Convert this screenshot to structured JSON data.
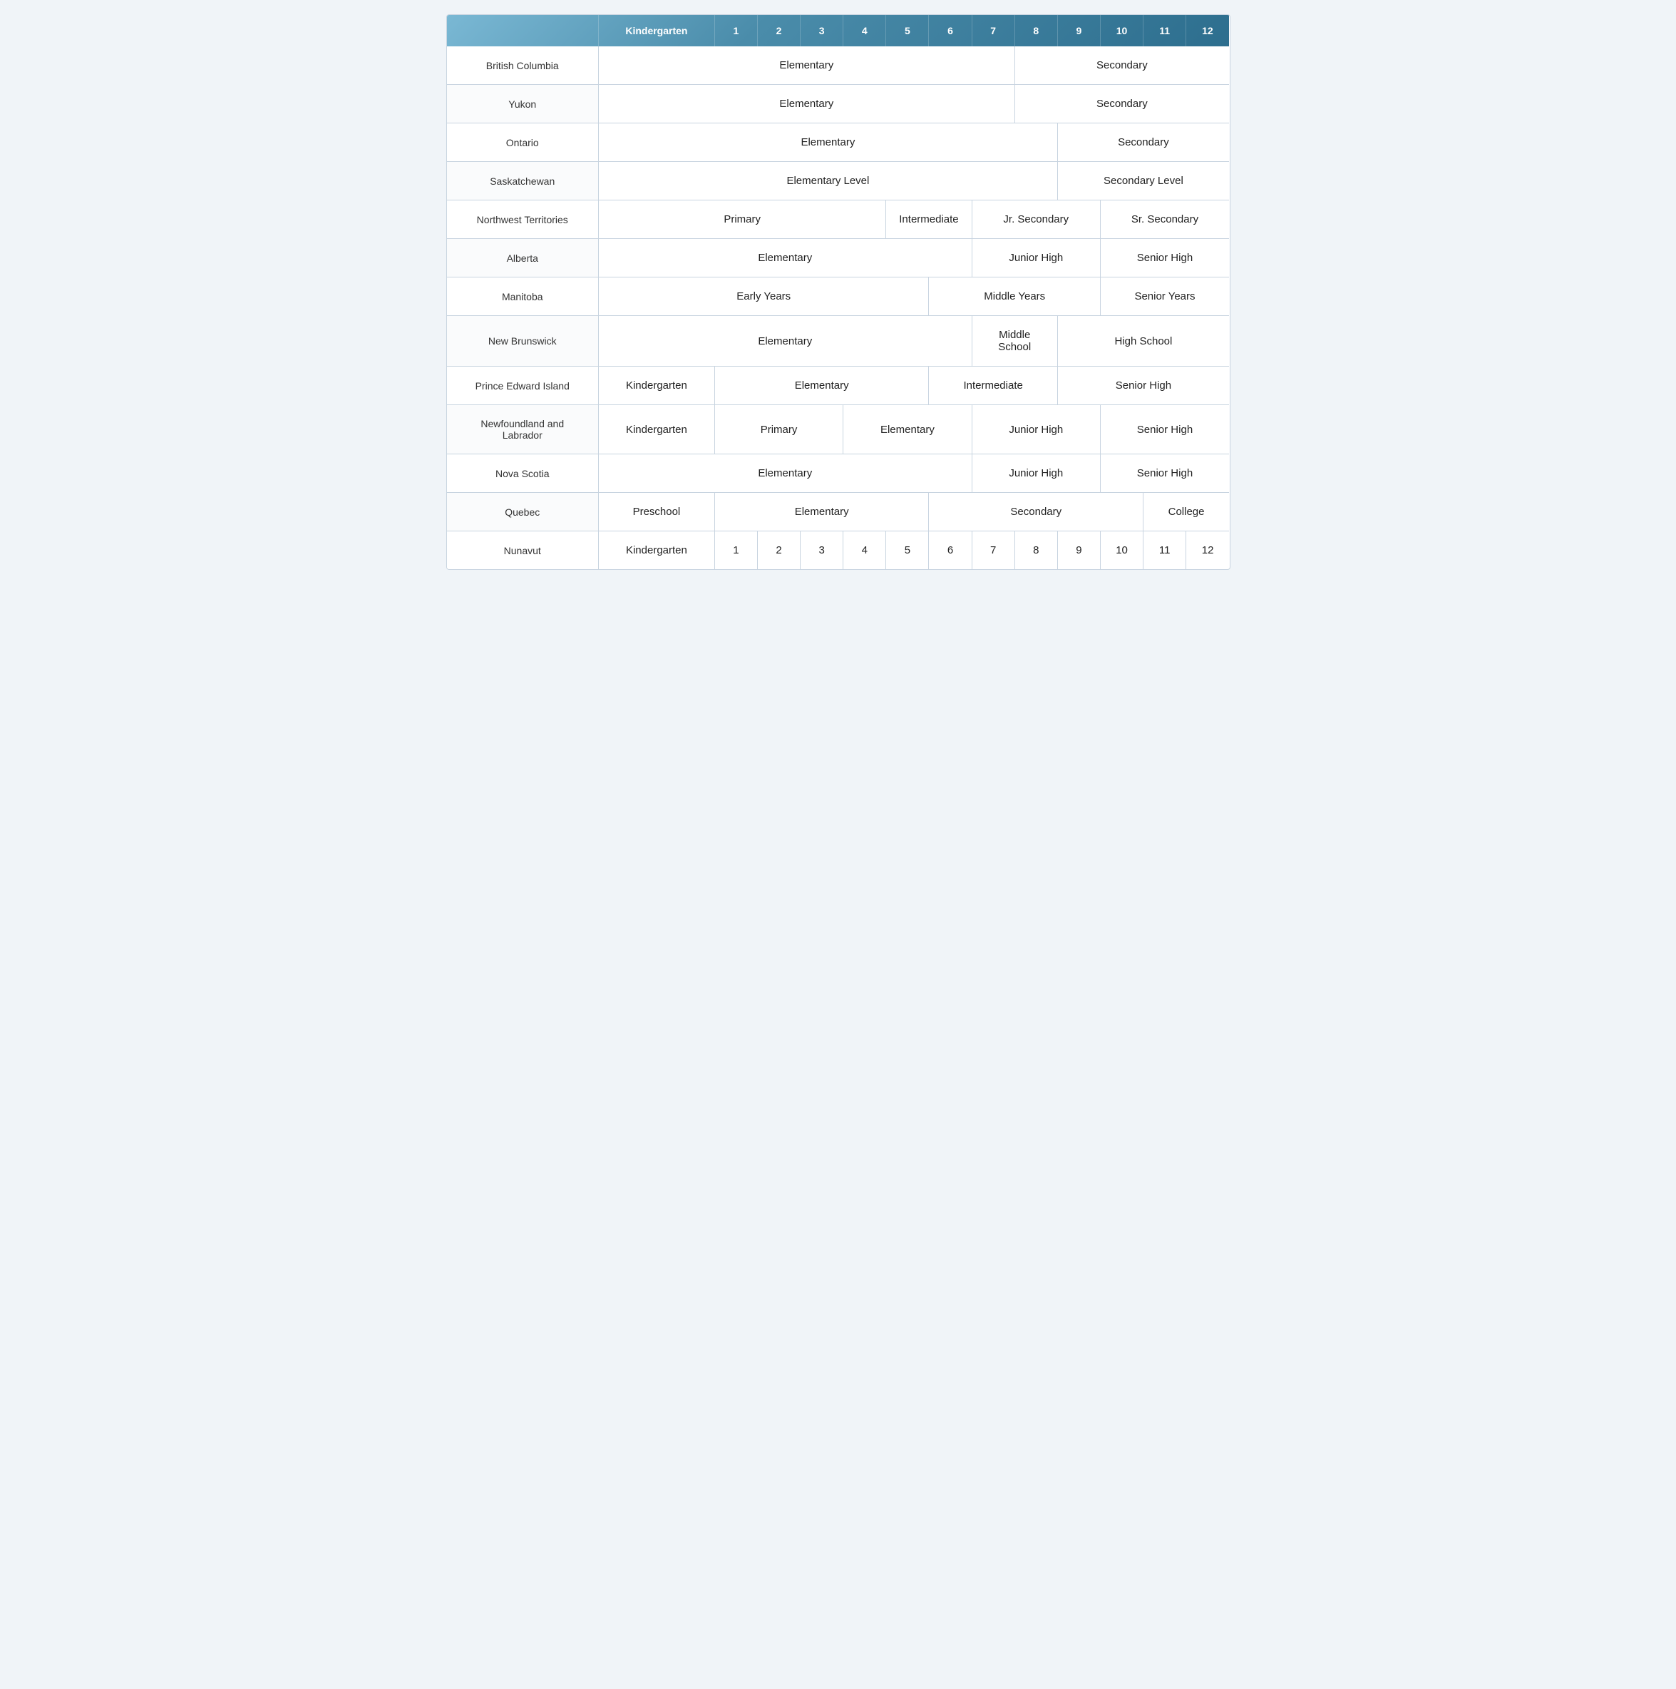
{
  "header": {
    "col0": "",
    "colKG": "Kindergarten",
    "col1": "1",
    "col2": "2",
    "col3": "3",
    "col4": "4",
    "col5": "5",
    "col6": "6",
    "col7": "7",
    "col8": "8",
    "col9": "9",
    "col10": "10",
    "col11": "11",
    "col12": "12"
  },
  "rows": [
    {
      "province": "British Columbia",
      "cells": [
        {
          "label": "Elementary",
          "colspan": 8,
          "grades": "K-7"
        },
        {
          "label": "Secondary",
          "colspan": 5,
          "grades": "8-12"
        }
      ]
    },
    {
      "province": "Yukon",
      "cells": [
        {
          "label": "Elementary",
          "colspan": 8,
          "grades": "K-7"
        },
        {
          "label": "Secondary",
          "colspan": 5,
          "grades": "8-12"
        }
      ]
    },
    {
      "province": "Ontario",
      "cells": [
        {
          "label": "Elementary",
          "colspan": 9,
          "grades": "K-8"
        },
        {
          "label": "Secondary",
          "colspan": 4,
          "grades": "9-12"
        }
      ]
    },
    {
      "province": "Saskatchewan",
      "cells": [
        {
          "label": "Elementary Level",
          "colspan": 9,
          "grades": "K-8"
        },
        {
          "label": "Secondary Level",
          "colspan": 4,
          "grades": "9-12"
        }
      ]
    },
    {
      "province": "Northwest Territories",
      "cells": [
        {
          "label": "Primary",
          "colspan": 5,
          "grades": "K-4"
        },
        {
          "label": "Intermediate",
          "colspan": 2,
          "grades": "5-6"
        },
        {
          "label": "Jr. Secondary",
          "colspan": 3,
          "grades": "7-9"
        },
        {
          "label": "Sr. Secondary",
          "colspan": 3,
          "grades": "10-12"
        }
      ]
    },
    {
      "province": "Alberta",
      "cells": [
        {
          "label": "Elementary",
          "colspan": 7,
          "grades": "K-6"
        },
        {
          "label": "Junior High",
          "colspan": 3,
          "grades": "7-9"
        },
        {
          "label": "Senior High",
          "colspan": 3,
          "grades": "10-12"
        }
      ]
    },
    {
      "province": "Manitoba",
      "cells": [
        {
          "label": "Early Years",
          "colspan": 6,
          "grades": "K-5"
        },
        {
          "label": "Middle Years",
          "colspan": 4,
          "grades": "6-9"
        },
        {
          "label": "Senior Years",
          "colspan": 3,
          "grades": "10-12"
        }
      ]
    },
    {
      "province": "New Brunswick",
      "cells": [
        {
          "label": "Elementary",
          "colspan": 7,
          "grades": "K-6"
        },
        {
          "label": "Middle\nSchool",
          "colspan": 2,
          "grades": "7-8"
        },
        {
          "label": "High School",
          "colspan": 4,
          "grades": "9-12"
        }
      ]
    },
    {
      "province": "Prince Edward Island",
      "cells": [
        {
          "label": "Kindergarten",
          "colspan": 1,
          "grades": "K"
        },
        {
          "label": "Elementary",
          "colspan": 5,
          "grades": "1-5"
        },
        {
          "label": "Intermediate",
          "colspan": 3,
          "grades": "6-8"
        },
        {
          "label": "Senior High",
          "colspan": 4,
          "grades": "9-12"
        }
      ]
    },
    {
      "province": "Newfoundland and\nLabrador",
      "cells": [
        {
          "label": "Kindergarten",
          "colspan": 1,
          "grades": "K"
        },
        {
          "label": "Primary",
          "colspan": 3,
          "grades": "1-3"
        },
        {
          "label": "Elementary",
          "colspan": 3,
          "grades": "4-6"
        },
        {
          "label": "Junior High",
          "colspan": 3,
          "grades": "7-9"
        },
        {
          "label": "Senior High",
          "colspan": 3,
          "grades": "10-12"
        }
      ]
    },
    {
      "province": "Nova Scotia",
      "cells": [
        {
          "label": "Elementary",
          "colspan": 7,
          "grades": "K-6"
        },
        {
          "label": "Junior High",
          "colspan": 3,
          "grades": "7-9"
        },
        {
          "label": "Senior High",
          "colspan": 3,
          "grades": "10-12"
        }
      ]
    },
    {
      "province": "Quebec",
      "cells": [
        {
          "label": "Preschool",
          "colspan": 1,
          "grades": "K"
        },
        {
          "label": "Elementary",
          "colspan": 5,
          "grades": "1-5"
        },
        {
          "label": "Secondary",
          "colspan": 5,
          "grades": "6-10"
        },
        {
          "label": "College",
          "colspan": 2,
          "grades": "11-12"
        }
      ]
    },
    {
      "province": "Nunavut",
      "cells_individual": [
        "Kindergarten",
        "1",
        "2",
        "3",
        "4",
        "5",
        "6",
        "7",
        "8",
        "9",
        "10",
        "11",
        "12"
      ]
    }
  ]
}
